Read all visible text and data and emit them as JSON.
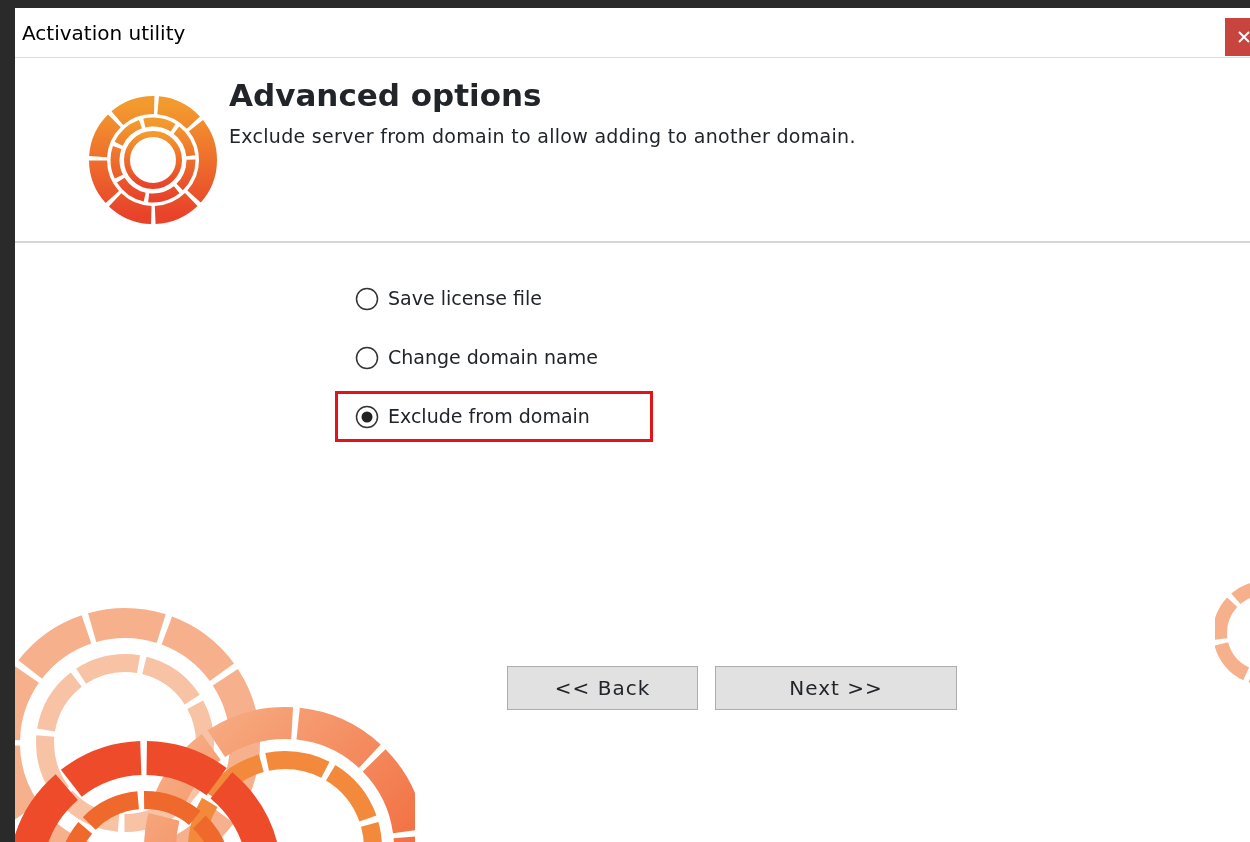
{
  "window": {
    "title": "Activation utility"
  },
  "header": {
    "title": "Advanced options",
    "subtitle": "Exclude server from domain to allow adding to another domain."
  },
  "options": [
    {
      "label": "Save license file",
      "selected": false,
      "highlighted": false
    },
    {
      "label": "Change domain name",
      "selected": false,
      "highlighted": false
    },
    {
      "label": "Exclude from domain",
      "selected": true,
      "highlighted": true
    }
  ],
  "buttons": [
    {
      "label": "<< Back"
    },
    {
      "label": "Next >>"
    }
  ]
}
